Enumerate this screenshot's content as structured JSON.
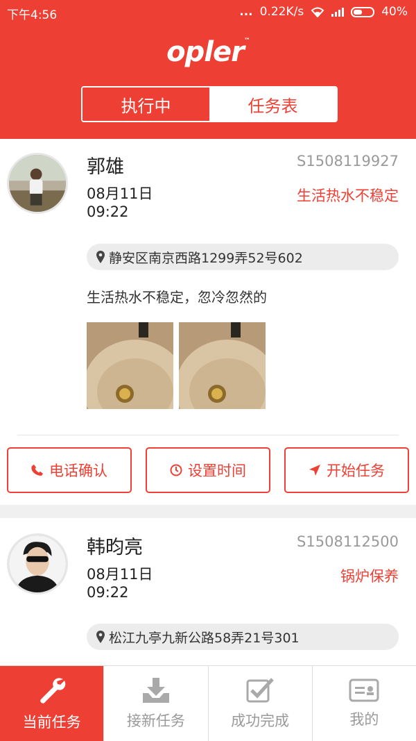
{
  "status_bar": {
    "time": "下午4:56",
    "dots": "...",
    "speed": "0.22K/s",
    "battery": "40%"
  },
  "header": {
    "logo_text": "opler",
    "logo_tm": "™",
    "tabs": [
      {
        "label": "执行中",
        "active": true
      },
      {
        "label": "任务表",
        "active": false
      }
    ]
  },
  "tasks": [
    {
      "name": "郭雄",
      "order_id": "S1508119927",
      "date": "08月11日",
      "time": "09:22",
      "issue_type": "生活热水不稳定",
      "address": "静安区南京西路1299弄52号602",
      "description": "生活热水不稳定，忽冷忽然的",
      "actions": [
        "电话确认",
        "设置时间",
        "开始任务"
      ]
    },
    {
      "name": "韩昀亮",
      "order_id": "S1508112500",
      "date": "08月11日",
      "time": "09:22",
      "issue_type": "锅炉保养",
      "address": "松江九亭九新公路58弄21号301"
    }
  ],
  "tabbar": [
    {
      "label": "当前任务",
      "icon": "wrench-icon",
      "active": true
    },
    {
      "label": "接新任务",
      "icon": "download-icon",
      "active": false
    },
    {
      "label": "成功完成",
      "icon": "checkbox-icon",
      "active": false
    },
    {
      "label": "我的",
      "icon": "id-card-icon",
      "active": false
    }
  ],
  "colors": {
    "accent": "#ee3f34",
    "muted": "#9a9a9a"
  }
}
